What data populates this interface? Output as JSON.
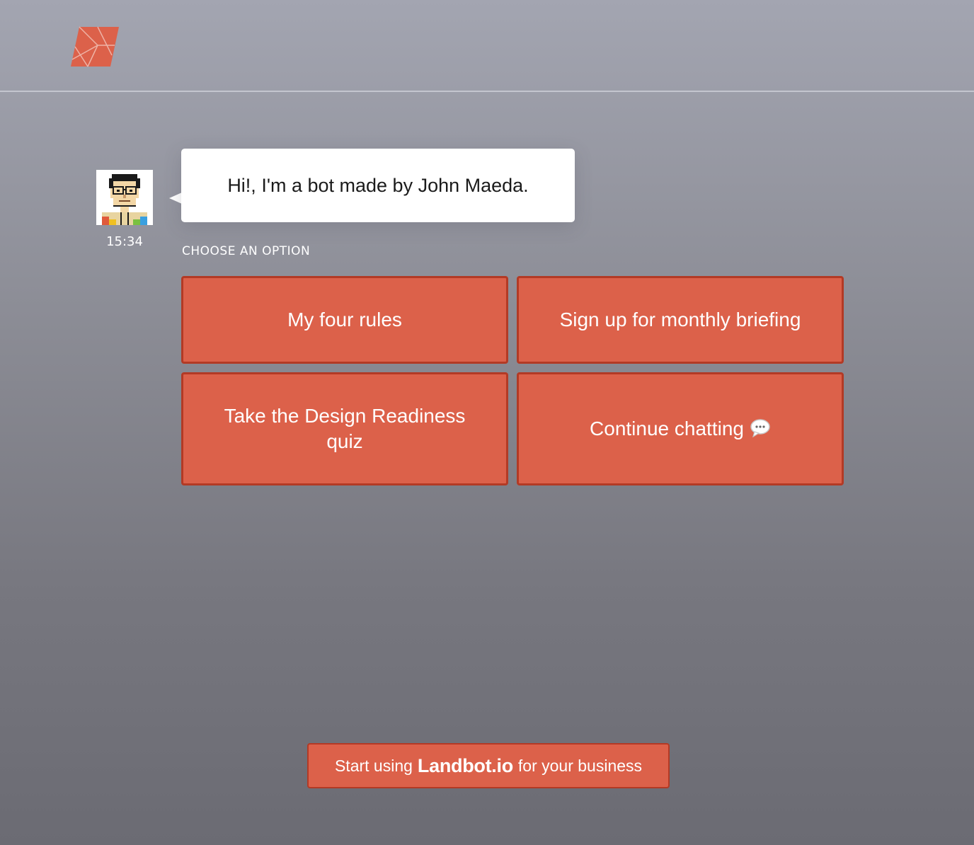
{
  "header": {
    "logo_icon": "maeda-logo-icon",
    "brand_color": "#dc614a"
  },
  "bot": {
    "avatar_icon": "pixel-portrait-avatar",
    "timestamp": "15:34",
    "message": "Hi!, I'm a bot made by John Maeda."
  },
  "options": {
    "label": "CHOOSE AN OPTION",
    "items": [
      {
        "label": "My four rules"
      },
      {
        "label": "Sign up for monthly briefing"
      },
      {
        "label": "Take the Design Readiness quiz"
      },
      {
        "label": "Continue chatting",
        "icon": "speech-bubble-icon"
      }
    ]
  },
  "footer": {
    "cta_prefix": "Start using",
    "cta_brand": "Landbot.io",
    "cta_suffix": "for your business"
  },
  "colors": {
    "accent": "#dc614a",
    "accent_border": "#b33a25",
    "text_on_accent": "#ffffff"
  }
}
